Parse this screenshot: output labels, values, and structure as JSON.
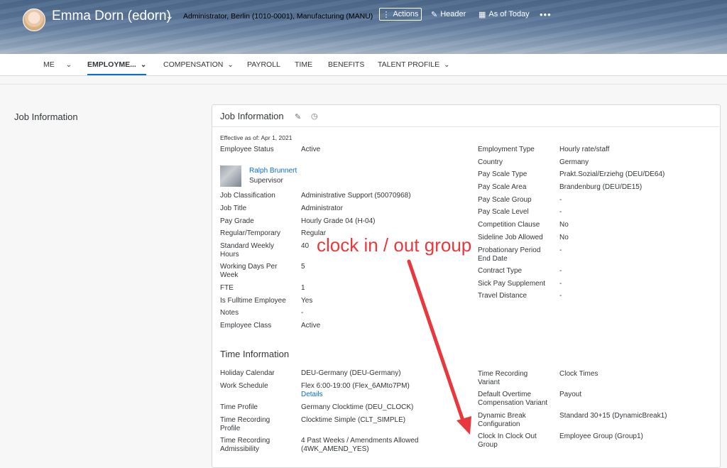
{
  "header": {
    "name": "Emma Dorn (edorn)",
    "subtitle": "Administrator, Berlin (1010-0001), Manufacturing (MANU)",
    "actions_label": "Actions",
    "header_label": "Header",
    "asof_label": "As of Today",
    "more": "•••"
  },
  "tabs": [
    "ME",
    "EMPLOYME...",
    "COMPENSATION",
    "PAYROLL",
    "TIME",
    "BENEFITS",
    "TALENT PROFILE"
  ],
  "left_title": "Job Information",
  "card": {
    "title": "Job Information",
    "effective": "Effective as of: Apr 1, 2021",
    "left_fields": [
      {
        "label": "Employee Status",
        "value": "Active"
      },
      {
        "label": "Job Classification",
        "value": "Administrative Support (50070968)"
      },
      {
        "label": "Job Title",
        "value": "Administrator"
      },
      {
        "label": "Pay Grade",
        "value": "Hourly Grade 04 (H-04)"
      },
      {
        "label": "Regular/Temporary",
        "value": "Regular"
      },
      {
        "label": "Standard Weekly Hours",
        "value": "40"
      },
      {
        "label": "Working Days Per Week",
        "value": "5"
      },
      {
        "label": "FTE",
        "value": "1"
      },
      {
        "label": "Is Fulltime Employee",
        "value": "Yes"
      },
      {
        "label": "Notes",
        "value": "-"
      },
      {
        "label": "Employee Class",
        "value": "Active"
      }
    ],
    "supervisor": {
      "name": "Ralph Brunnert",
      "role": "Supervisor"
    },
    "right_fields": [
      {
        "label": "Employment Type",
        "value": "Hourly rate/staff"
      },
      {
        "label": "Country",
        "value": "Germany"
      },
      {
        "label": "Pay Scale Type",
        "value": "Prakt.Sozial/Erziehg (DEU/DE64)"
      },
      {
        "label": "Pay Scale Area",
        "value": "Brandenburg (DEU/DE15)"
      },
      {
        "label": "Pay Scale Group",
        "value": "-"
      },
      {
        "label": "Pay Scale Level",
        "value": "-"
      },
      {
        "label": "Competition Clause",
        "value": "No"
      },
      {
        "label": "Sideline Job Allowed",
        "value": "No"
      },
      {
        "label": "Probationary Period End Date",
        "value": "-"
      },
      {
        "label": "Contract Type",
        "value": "-"
      },
      {
        "label": "Sick Pay Supplement",
        "value": "-"
      },
      {
        "label": "Travel Distance",
        "value": "-"
      }
    ]
  },
  "time": {
    "title": "Time Information",
    "left_fields": [
      {
        "label": "Holiday Calendar",
        "value": "DEU-Germany (DEU-Germany)"
      },
      {
        "label": "Work Schedule",
        "value": "Flex 6:00-19:00 (Flex_6AMto7PM)",
        "link": "Details"
      },
      {
        "label": "Time Profile",
        "value": "Germany Clocktime (DEU_CLOCK)"
      },
      {
        "label": "Time Recording Profile",
        "value": "Clocktime Simple (CLT_SIMPLE)"
      },
      {
        "label": "Time Recording Admissibility",
        "value": "4 Past Weeks / Amendments Allowed (4WK_AMEND_YES)"
      }
    ],
    "right_fields": [
      {
        "label": "Time Recording Variant",
        "value": "Clock Times"
      },
      {
        "label": "Default Overtime Compensation Variant",
        "value": "Payout"
      },
      {
        "label": "Dynamic Break Configuration",
        "value": "Standard 30+15 (DynamicBreak1)"
      },
      {
        "label": "Clock In Clock Out Group",
        "value": "Employee Group (Group1)"
      }
    ]
  },
  "annotation": "clock in / out group",
  "colors": {
    "accent": "#0a6ed1",
    "annotation": "#e8383d"
  }
}
